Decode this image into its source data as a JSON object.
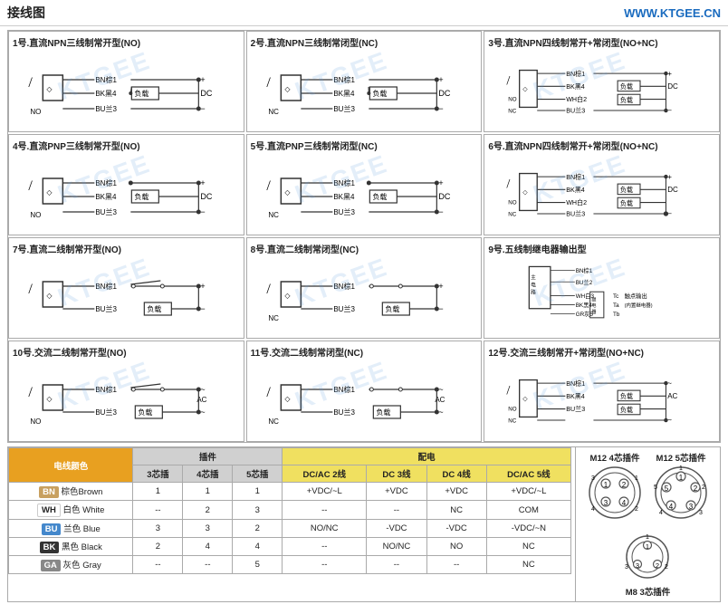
{
  "header": {
    "title": "接线图",
    "url": "WWW.KTGEE.CN"
  },
  "diagrams": [
    {
      "id": 1,
      "title": "1号.直流NPN三线制常开型(NO)",
      "type": "npn3no",
      "labels": [
        "BN棕1",
        "BK黑4",
        "BU兰3",
        "NO"
      ],
      "polarity": [
        "+",
        "DC",
        "-"
      ],
      "load": "负载"
    },
    {
      "id": 2,
      "title": "2号.直流NPN三线制常闭型(NC)",
      "type": "npn3nc",
      "labels": [
        "BN棕1",
        "BK黑4",
        "BU兰3",
        "NC"
      ],
      "polarity": [
        "+",
        "DC",
        "-"
      ],
      "load": "负载"
    },
    {
      "id": 3,
      "title": "3号.直流NPN四线制常开+常闭型(NO+NC)",
      "type": "npn4nonc",
      "labels": [
        "BN棕1",
        "BK黑4",
        "WH白2",
        "BU兰3",
        "NO",
        "NC"
      ],
      "polarity": [
        "+",
        "DC",
        "-"
      ],
      "load": "负载"
    },
    {
      "id": 4,
      "title": "4号.直流PNP三线制常开型(NO)",
      "type": "pnp3no",
      "labels": [
        "BN棕1",
        "BK黑4",
        "BU兰3",
        "NO"
      ],
      "polarity": [
        "+",
        "DC",
        "-"
      ],
      "load": "负载"
    },
    {
      "id": 5,
      "title": "5号.直流PNP三线制常闭型(NC)",
      "type": "pnp3nc",
      "labels": [
        "BN棕1",
        "BK黑4",
        "BU兰3",
        "NC"
      ],
      "polarity": [
        "+",
        "DC",
        "-"
      ],
      "load": "负载"
    },
    {
      "id": 6,
      "title": "6号.直流NPN四线制常开+常闭型(NO+NC)",
      "type": "npn4nonc2",
      "labels": [
        "BN棕1",
        "BK黑4",
        "WH白2",
        "BU兰3",
        "NO",
        "NC"
      ],
      "polarity": [
        "+",
        "DC",
        "-"
      ],
      "load": "负载"
    },
    {
      "id": 7,
      "title": "7号.直流二线制常开型(NO)",
      "type": "2wire_no",
      "labels": [
        "BN棕1",
        "BU兰3"
      ],
      "polarity": [
        "+",
        "-"
      ],
      "load": "负载"
    },
    {
      "id": 8,
      "title": "8号.直流二线制常闭型(NC)",
      "type": "2wire_nc",
      "labels": [
        "BN棕1",
        "BU兰3",
        "NC"
      ],
      "polarity": [
        "+",
        "-"
      ],
      "load": "负载"
    },
    {
      "id": 9,
      "title": "9号.五线制继电器输出型",
      "type": "5wire_relay",
      "labels": [
        "BN棕1",
        "BU兰2",
        "WH白3",
        "BK黑4",
        "GR灰5"
      ],
      "relay_labels": [
        "Tc",
        "Ta",
        "Tb"
      ],
      "output": "触点输出",
      "note": "(内置继电器)"
    },
    {
      "id": 10,
      "title": "10号.交流二线制常开型(NO)",
      "type": "ac2wire_no",
      "labels": [
        "BN棕1",
        "BU兰3",
        "NO"
      ],
      "polarity": [
        "~",
        "AC",
        "~"
      ],
      "load": "负载"
    },
    {
      "id": 11,
      "title": "11号.交流二线制常闭型(NC)",
      "type": "ac2wire_nc",
      "labels": [
        "BN棕1",
        "BU兰3",
        "NC"
      ],
      "polarity": [
        "~",
        "AC",
        "~"
      ],
      "load": "负载"
    },
    {
      "id": 12,
      "title": "12号.交流三线制常开+常闭型(NO+NC)",
      "type": "ac3wire_nonc",
      "labels": [
        "BN棕1",
        "BK黑4",
        "BU兰3",
        "NO",
        "NC"
      ],
      "polarity": [
        "~",
        "AC",
        "~"
      ],
      "load": "负载"
    }
  ],
  "table": {
    "header1": "电线颜色",
    "header2": "插件",
    "header3": "配电",
    "col_plugin": [
      "3芯插",
      "4芯插",
      "5芯插"
    ],
    "col_power": [
      "DC/AC 2线",
      "DC 3线",
      "DC 4线",
      "DC/AC 5线"
    ],
    "rows": [
      {
        "code": "BN",
        "name": "棕色Brown",
        "p3": "1",
        "p4": "1",
        "p5": "1",
        "d2": "+VDC/~L",
        "d3": "+VDC",
        "d4": "+VDC",
        "d5": "+VDC/~L"
      },
      {
        "code": "WH",
        "name": "白色 White",
        "p3": "--",
        "p4": "2",
        "p5": "3",
        "d2": "--",
        "d3": "--",
        "d4": "NC",
        "d5": "COM"
      },
      {
        "code": "BU",
        "name": "兰色 Blue",
        "p3": "3",
        "p4": "3",
        "p5": "2",
        "d2": "NO/NC",
        "d3": "-VDC",
        "d4": "-VDC",
        "d5": "-VDC/~N"
      },
      {
        "code": "BK",
        "name": "黑色 Black",
        "p3": "2",
        "p4": "4",
        "p5": "4",
        "d2": "--",
        "d3": "NO/NC",
        "d4": "NO",
        "d5": "NC"
      },
      {
        "code": "GA",
        "name": "灰色 Gray",
        "p3": "--",
        "p4": "--",
        "p5": "5",
        "d2": "--",
        "d3": "--",
        "d4": "--",
        "d5": "NC"
      }
    ],
    "connector_titles": [
      "M12 4芯插件",
      "M12 5芯插件",
      "M8 3芯插件"
    ]
  },
  "watermark": "KTGEE"
}
